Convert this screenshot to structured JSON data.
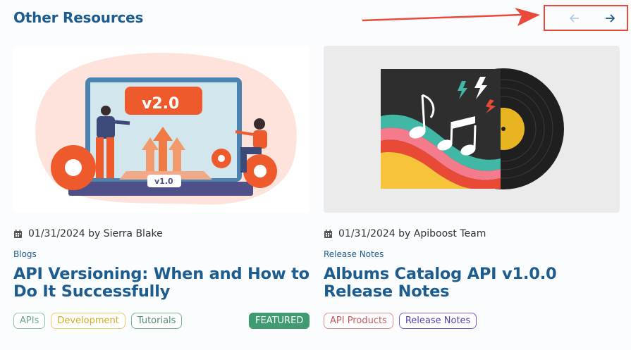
{
  "section": {
    "title": "Other Resources"
  },
  "nav": {
    "prev_label": "←",
    "next_label": "→"
  },
  "cards": [
    {
      "date_author": "01/31/2024 by Sierra Blake",
      "category": "Blogs",
      "title": "API Versioning: When and How to Do It Successfully",
      "tags": [
        "APIs",
        "Development",
        "Tutorials"
      ],
      "badge": "FEATURED",
      "image": {
        "version_big": "v2.0",
        "version_small": "v1.0"
      }
    },
    {
      "date_author": "01/31/2024 by Apiboost Team",
      "category": "Release Notes",
      "title": "Albums Catalog API v1.0.0 Release Notes",
      "tags": [
        "API Products",
        "Release Notes"
      ]
    }
  ]
}
